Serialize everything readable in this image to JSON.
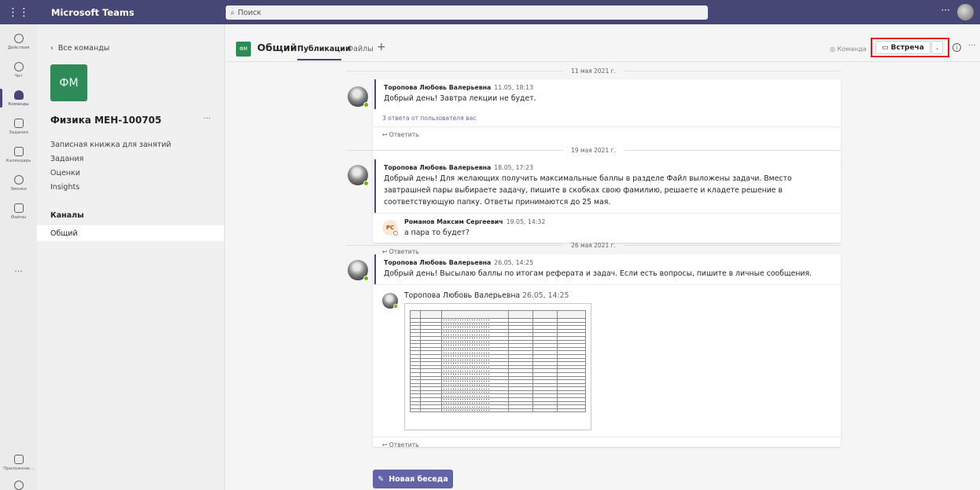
{
  "titlebar": {
    "app_title": "Microsoft Teams",
    "search_placeholder": "Поиск"
  },
  "rail": {
    "items": [
      {
        "label": "Действия",
        "icon": "bell-icon"
      },
      {
        "label": "Чат",
        "icon": "chat-icon"
      },
      {
        "label": "Команды",
        "icon": "teams-icon"
      },
      {
        "label": "Задания",
        "icon": "assignments-icon"
      },
      {
        "label": "Календарь",
        "icon": "calendar-icon"
      },
      {
        "label": "Звонки",
        "icon": "phone-icon"
      },
      {
        "label": "Файлы",
        "icon": "file-icon"
      }
    ],
    "more": "...",
    "apps_label": "Приложени..."
  },
  "team_panel": {
    "back_label": "Все команды",
    "team_initials": "ФМ",
    "team_name": "Физика МЕН-100705",
    "links": [
      "Записная книжка для занятий",
      "Задания",
      "Оценки",
      "Insights"
    ],
    "channels_header": "Каналы",
    "channels": [
      "Общий"
    ]
  },
  "channel_header": {
    "initials": "ФМ",
    "title": "Общий",
    "tabs": [
      "Публикации",
      "Файлы"
    ],
    "add_tab": "+",
    "team_label": "Команда",
    "meet_label": "Встреча"
  },
  "feed": {
    "dates": [
      "11 мая 2021 г.",
      "19 мая 2021 г.",
      "26 мая 2021 г."
    ],
    "reply_label": "Ответить",
    "posts": [
      {
        "author": "Торопова Любовь Валерьевна",
        "time": "11.05, 18:13",
        "text": "Добрый день! Завтра лекции не будет.",
        "replies_link": "3 ответа от пользователя вас"
      },
      {
        "author": "Торопова Любовь Валерьевна",
        "time": "18.05, 17:23",
        "text": "Добрый день! Для желающих получить максимальные баллы в разделе Файл выложены задачи. Вместо завтрашней пары выбираете задачу, пишите в скобках свою фамилию, решаете и кладете решение в соответствующую папку. Ответы принимаются до 25 мая.",
        "reply": {
          "initials": "РС",
          "author": "Романов Максим Сергеевич",
          "time": "19.05, 14:32",
          "text": "а пара то будет?"
        }
      },
      {
        "author": "Торопова Любовь Валерьевна",
        "time": "26.05, 14:25",
        "text": "Добрый день! Высылаю баллы по итогам реферата и задач. Если есть вопросы, пишите в личные сообщения.",
        "attachment": {
          "author": "Торопова Любовь Валерьевна",
          "time": "26.05, 14:25"
        }
      }
    ]
  },
  "new_post_label": "Новая беседа"
}
